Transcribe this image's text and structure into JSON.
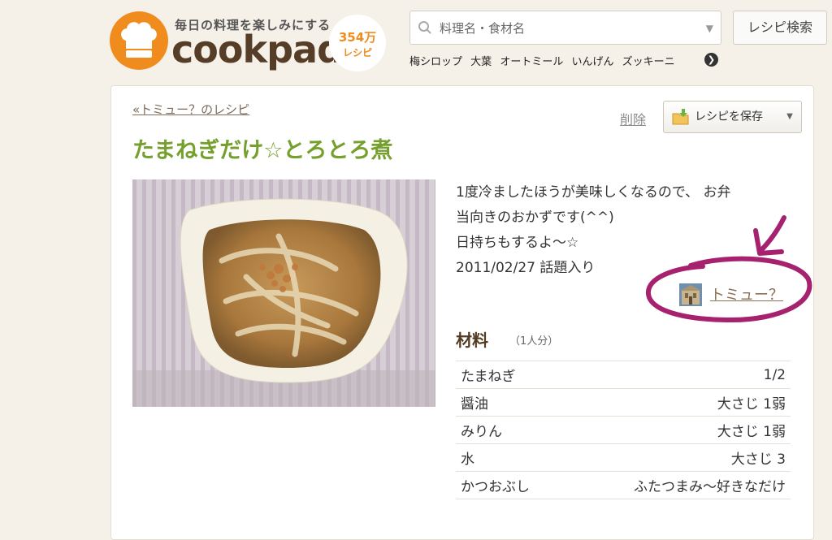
{
  "header": {
    "logo": {
      "tagline": "毎日の料理を楽しみにする",
      "wordmark": "cookpad",
      "recipe_count": "354万",
      "recipe_count_unit": "レシピ",
      "brand_color": "#f08c1e"
    },
    "search": {
      "placeholder": "料理名・食材名",
      "button_label": "レシピ検索"
    },
    "keywords": [
      "梅シロップ",
      "大葉",
      "オートミール",
      "いんげん",
      "ズッキーニ"
    ]
  },
  "recipe": {
    "breadcrumb": "«トミュー？のレシピ",
    "delete_label": "削除",
    "save_label": "レシピを保存",
    "title": "たまねぎだけ☆とろとろ煮",
    "description": [
      "1度冷ましたほうが美味しくなるので、 お弁",
      "当向きのおかずです(^^)",
      "日持ちもするよ～☆",
      "2011/02/27 話題入り"
    ],
    "author": "トミュー？",
    "title_color": "#76a02e",
    "annotation_color": "#a6226f"
  },
  "ingredients": {
    "title": "材料",
    "serving": "（1人分）",
    "items": [
      {
        "name": "たまねぎ",
        "qty": "1/2"
      },
      {
        "name": "醤油",
        "qty": "大さじ 1弱"
      },
      {
        "name": "みりん",
        "qty": "大さじ 1弱"
      },
      {
        "name": "水",
        "qty": "大さじ 3"
      },
      {
        "name": "かつおぶし",
        "qty": "ふたつまみ～好きなだけ"
      }
    ]
  }
}
